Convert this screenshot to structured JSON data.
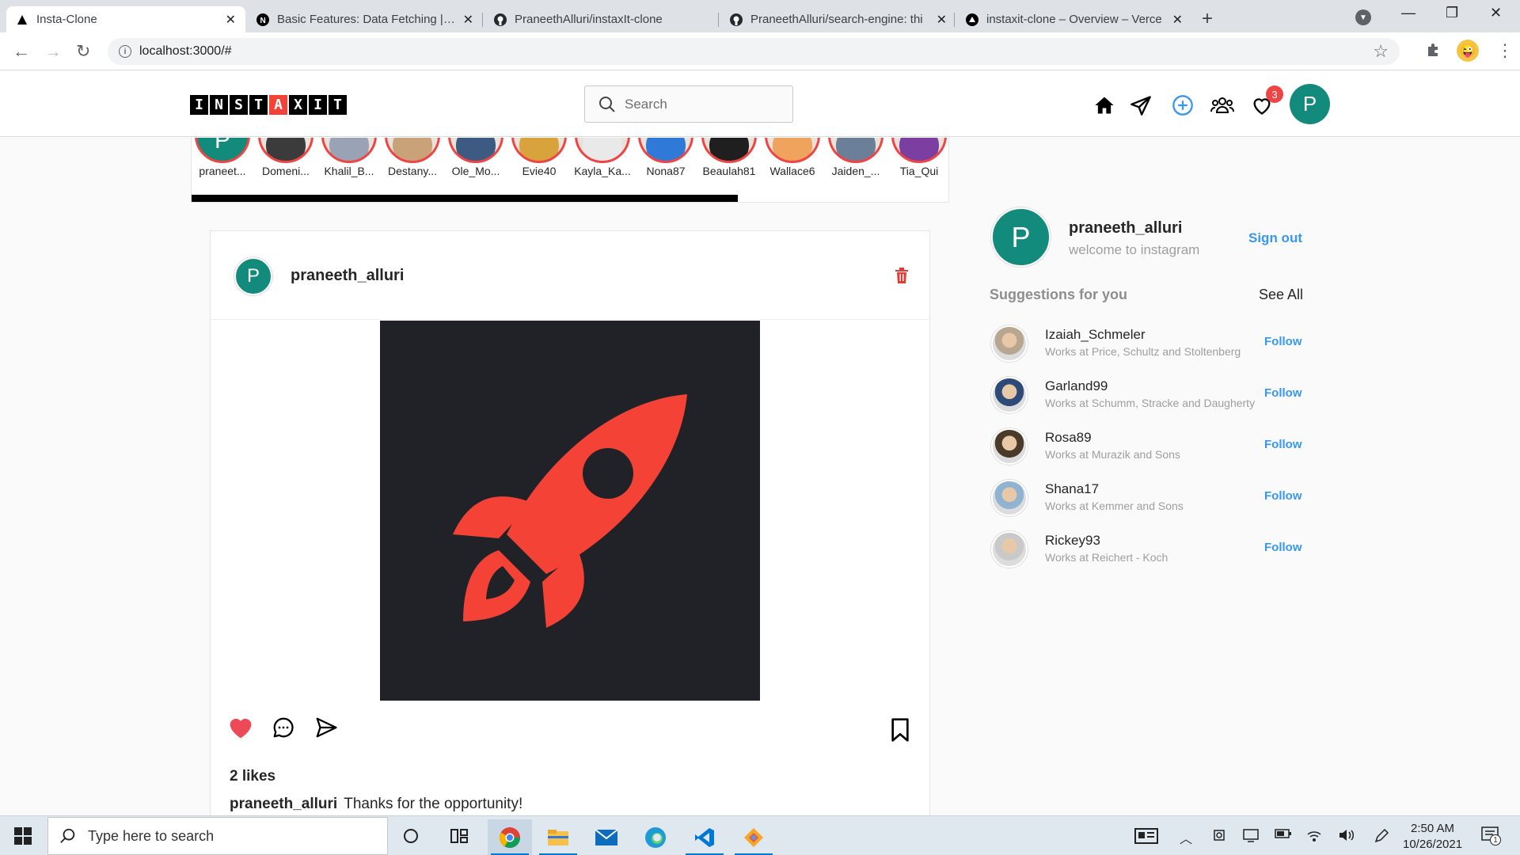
{
  "browser": {
    "tabs": [
      {
        "title": "Insta-Clone",
        "icon": "triangle-icon",
        "active": true
      },
      {
        "title": "Basic Features: Data Fetching | Ne",
        "icon": "nextjs-icon",
        "active": false
      },
      {
        "title": "PraneethAlluri/instaxIt-clone",
        "icon": "github-icon",
        "active": false
      },
      {
        "title": "PraneethAlluri/search-engine: thi",
        "icon": "github-icon",
        "active": false
      },
      {
        "title": "instaxit-clone – Overview – Verce",
        "icon": "vercel-icon",
        "active": false
      }
    ],
    "url": "localhost:3000/#"
  },
  "header": {
    "logo_letters": [
      "I",
      "N",
      "S",
      "T",
      "A",
      "X",
      "I",
      "T"
    ],
    "logo_accent_index": 4,
    "search_placeholder": "Search",
    "notification_count": "3",
    "avatar_initial": "P"
  },
  "stories": [
    {
      "name": "praneet...",
      "kind": "initial",
      "initial": "P"
    },
    {
      "name": "Domeni...",
      "kind": "face",
      "tone": "#3b3b3b"
    },
    {
      "name": "Khalil_B...",
      "kind": "face",
      "tone": "#9aa3b5"
    },
    {
      "name": "Destany...",
      "kind": "face",
      "tone": "#c9a27a"
    },
    {
      "name": "Ole_Mo...",
      "kind": "face",
      "tone": "#3d5b82"
    },
    {
      "name": "Evie40",
      "kind": "face",
      "tone": "#d8a33c"
    },
    {
      "name": "Kayla_Ka...",
      "kind": "face",
      "tone": "#e9e9e9"
    },
    {
      "name": "Nona87",
      "kind": "face",
      "tone": "#2f7ad8"
    },
    {
      "name": "Beaulah81",
      "kind": "face",
      "tone": "#1f1f1f"
    },
    {
      "name": "Wallace6",
      "kind": "face",
      "tone": "#f0a35c"
    },
    {
      "name": "Jaiden_...",
      "kind": "face",
      "tone": "#6b7f99"
    },
    {
      "name": "Tia_Qui",
      "kind": "face",
      "tone": "#7a3fa0"
    }
  ],
  "post": {
    "username": "praneeth_alluri",
    "avatar_initial": "P",
    "likes": "2 likes",
    "caption_user": "praneeth_alluri",
    "caption_text": "Thanks for the opportunity!",
    "image_icon": "rocket-icon",
    "image_bg": "#212227",
    "image_fg": "#f44336"
  },
  "sidebar": {
    "username": "praneeth_alluri",
    "subtitle": "welcome to instagram",
    "avatar_initial": "P",
    "sign_out": "Sign out",
    "suggestions_title": "Suggestions for you",
    "see_all": "See All",
    "suggestions": [
      {
        "username": "Izaiah_Schmeler",
        "work": "Works at Price, Schultz and Stoltenberg",
        "follow": "Follow",
        "tone": "#b7a690"
      },
      {
        "username": "Garland99",
        "work": "Works at Schumm, Stracke and Daugherty",
        "follow": "Follow",
        "tone": "#2e4a78"
      },
      {
        "username": "Rosa89",
        "work": "Works at Murazik and Sons",
        "follow": "Follow",
        "tone": "#4a3a2a"
      },
      {
        "username": "Shana17",
        "work": "Works at Kemmer and Sons",
        "follow": "Follow",
        "tone": "#8fb3d0"
      },
      {
        "username": "Rickey93",
        "work": "Works at Reichert - Koch",
        "follow": "Follow",
        "tone": "#c9c9c9"
      }
    ]
  },
  "taskbar": {
    "search_placeholder": "Type here to search",
    "time": "2:50 AM",
    "date": "10/26/2021",
    "notification_count": "1"
  },
  "colors": {
    "accent": "#3897f0",
    "brand_red": "#f44336",
    "avatar_teal": "#128a7c",
    "like_red": "#ed4956"
  }
}
